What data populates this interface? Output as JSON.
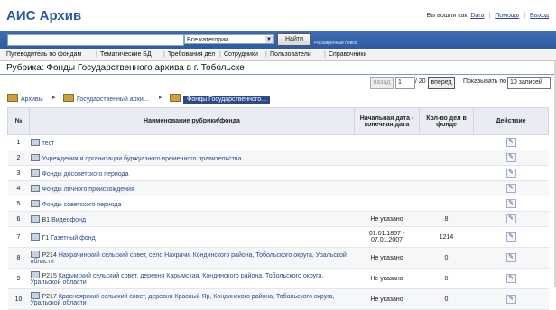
{
  "app": {
    "title": "АИС Архив"
  },
  "user": {
    "prefix": "Вы вошли как:",
    "name": "Dara",
    "help": "Помощь",
    "logout": "Выход"
  },
  "search": {
    "value": "",
    "category": "Все категории",
    "button": "Найти",
    "advanced": "Расширенный поиск"
  },
  "nav": [
    "Путеводитель по фондам",
    "Тематические БД",
    "Требования дел",
    "Сотрудники",
    "Пользователи",
    "Справочники"
  ],
  "rubric_title": "Рубрика: Фонды Государственного архива в г. Тобольске",
  "pager": {
    "back": "назад",
    "page": "1",
    "of": "/ 20",
    "forward": "вперед",
    "show_label": "Показывать по",
    "per_page": "10 записей"
  },
  "breadcrumb": [
    "Архивы",
    "Государственный архи...",
    "Фонды Государственного..."
  ],
  "table": {
    "headers": [
      "№",
      "Наименование рубрики/фонда",
      "Начальная дата - конечная дата",
      "Кол-во дел в фонде",
      "Действие"
    ],
    "rows": [
      {
        "num": "1",
        "code": "",
        "name": "тест",
        "dates": "",
        "count": ""
      },
      {
        "num": "2",
        "code": "",
        "name": "Учреждения и организации буржуазного временного правительства",
        "dates": "",
        "count": ""
      },
      {
        "num": "3",
        "code": "",
        "name": "Фонды досоветского периода",
        "dates": "",
        "count": ""
      },
      {
        "num": "4",
        "code": "",
        "name": "Фонды личного происхождения",
        "dates": "",
        "count": ""
      },
      {
        "num": "5",
        "code": "",
        "name": "Фонды советского периода",
        "dates": "",
        "count": ""
      },
      {
        "num": "6",
        "code": "В1",
        "name": "Видеофонд",
        "dates": "Не указано",
        "count": "8"
      },
      {
        "num": "7",
        "code": "Г1",
        "name": "Газетный фонд",
        "dates": "01.01.1857 - 07.01.2007",
        "count": "1214"
      },
      {
        "num": "8",
        "code": "Р214",
        "name": "Нахрачинский сельский совет, село Нахрачи, Кондинского района, Тобольского округа, Уральской области",
        "dates": "Не указано",
        "count": "0"
      },
      {
        "num": "9",
        "code": "Р215",
        "name": "Карымский сельский совет, деревня Карымская, Кондинского района, Тобольского округа, Уральской области",
        "dates": "Не указано",
        "count": "0"
      },
      {
        "num": "10",
        "code": "Р217",
        "name": "Красноярский сельский совет, деревня Красный Яр, Кондинского района, Тобольского округа, Уральской области",
        "dates": "Не указано",
        "count": "0"
      }
    ]
  }
}
